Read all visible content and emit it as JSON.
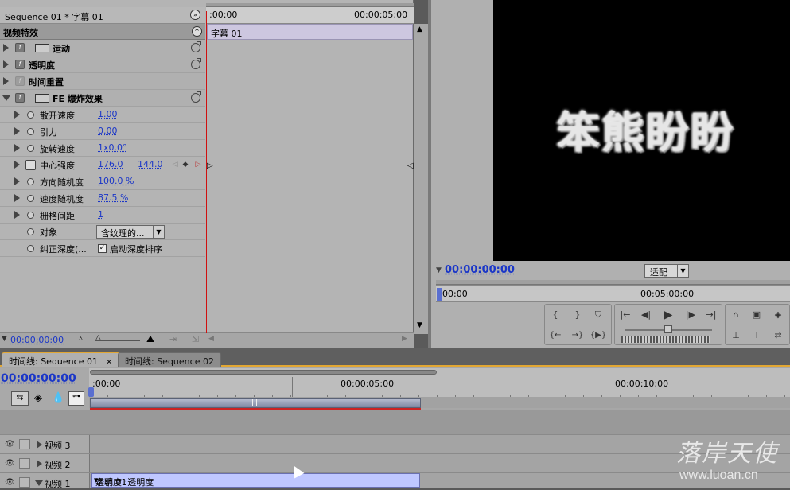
{
  "effect_controls": {
    "sequence_title": "Sequence 01 * 字幕 01",
    "ruler_start": ":00:00",
    "ruler_end": "00:00:05:00",
    "clip_name": "字幕 01",
    "section_header": "视频特效",
    "effects": [
      {
        "name": "运动"
      },
      {
        "name": "透明度"
      },
      {
        "name": "时间重置"
      },
      {
        "name": "FE 爆炸效果"
      }
    ],
    "params": [
      {
        "label": "散开速度",
        "value": "1.00"
      },
      {
        "label": "引力",
        "value": "0.00"
      },
      {
        "label": "旋转速度",
        "value": "1x0.0°"
      },
      {
        "label": "中心强度",
        "value": "176.0",
        "value2": "144.0"
      },
      {
        "label": "方向随机度",
        "value": "100.0 %"
      },
      {
        "label": "速度随机度",
        "value": "87.5 %"
      },
      {
        "label": "栅格间距",
        "value": "1"
      },
      {
        "label": "对象",
        "value": "含纹理的..."
      },
      {
        "label": "纠正深度(...",
        "value": "启动深度排序"
      }
    ],
    "footer_time": "00:00:00:00"
  },
  "program_monitor": {
    "screen_text": "笨熊盼盼",
    "timecode": "00:00:00:00",
    "fit_label": "适配",
    "ruler_start": "00:00",
    "ruler_mid": "00:05:00:00"
  },
  "timeline": {
    "tab1": "时间线: Sequence 01",
    "tab1_close": "×",
    "tab2": "时间线: Sequence 02",
    "timecode": "00:00:00:00",
    "ruler_labels": [
      ":00:00",
      "00:00:05:00",
      "00:00:10:00"
    ],
    "tracks": [
      "视频 3",
      "视频 2",
      "视频 1"
    ],
    "clip_label": "字幕 01",
    "clip_property": "透明度 :透明度"
  },
  "watermark": {
    "line1": "落岸天使",
    "line2": "www.luoan.cn"
  }
}
